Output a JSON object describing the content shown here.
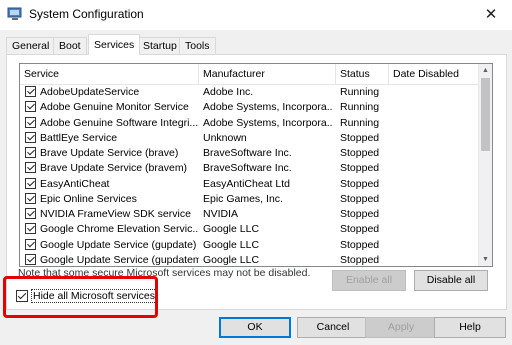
{
  "window": {
    "title": "System Configuration",
    "close_glyph": "✕"
  },
  "tabs": [
    {
      "label": "General"
    },
    {
      "label": "Boot"
    },
    {
      "label": "Services",
      "active": true
    },
    {
      "label": "Startup"
    },
    {
      "label": "Tools"
    }
  ],
  "table": {
    "columns": [
      "Service",
      "Manufacturer",
      "Status",
      "Date Disabled"
    ],
    "rows": [
      {
        "checked": true,
        "service": "AdobeUpdateService",
        "manufacturer": "Adobe Inc.",
        "status": "Running",
        "date": ""
      },
      {
        "checked": true,
        "service": "Adobe Genuine Monitor Service",
        "manufacturer": "Adobe Systems, Incorpora...",
        "status": "Running",
        "date": ""
      },
      {
        "checked": true,
        "service": "Adobe Genuine Software Integri...",
        "manufacturer": "Adobe Systems, Incorpora...",
        "status": "Running",
        "date": ""
      },
      {
        "checked": true,
        "service": "BattlEye Service",
        "manufacturer": "Unknown",
        "status": "Stopped",
        "date": ""
      },
      {
        "checked": true,
        "service": "Brave Update Service (brave)",
        "manufacturer": "BraveSoftware Inc.",
        "status": "Stopped",
        "date": ""
      },
      {
        "checked": true,
        "service": "Brave Update Service (bravem)",
        "manufacturer": "BraveSoftware Inc.",
        "status": "Stopped",
        "date": ""
      },
      {
        "checked": true,
        "service": "EasyAntiCheat",
        "manufacturer": "EasyAntiCheat Ltd",
        "status": "Stopped",
        "date": ""
      },
      {
        "checked": true,
        "service": "Epic Online Services",
        "manufacturer": "Epic Games, Inc.",
        "status": "Stopped",
        "date": ""
      },
      {
        "checked": true,
        "service": "NVIDIA FrameView SDK service",
        "manufacturer": "NVIDIA",
        "status": "Stopped",
        "date": ""
      },
      {
        "checked": true,
        "service": "Google Chrome Elevation Servic...",
        "manufacturer": "Google LLC",
        "status": "Stopped",
        "date": ""
      },
      {
        "checked": true,
        "service": "Google Update Service (gupdate)",
        "manufacturer": "Google LLC",
        "status": "Stopped",
        "date": ""
      },
      {
        "checked": true,
        "service": "Google Update Service (gupdatem)",
        "manufacturer": "Google LLC",
        "status": "Stopped",
        "date": ""
      }
    ]
  },
  "note": "Note that some secure Microsoft services may not be disabled.",
  "buttons": {
    "enable_all": "Enable all",
    "disable_all": "Disable all",
    "ok": "OK",
    "cancel": "Cancel",
    "apply": "Apply",
    "help": "Help"
  },
  "hide_ms": {
    "label": "Hide all Microsoft services",
    "checked": true
  },
  "colors": {
    "highlight": "#e60000",
    "focus": "#0078d7"
  },
  "icons": {
    "app": "system-config-icon",
    "scroll_up": "scroll-up-icon",
    "scroll_down": "scroll-down-icon"
  }
}
